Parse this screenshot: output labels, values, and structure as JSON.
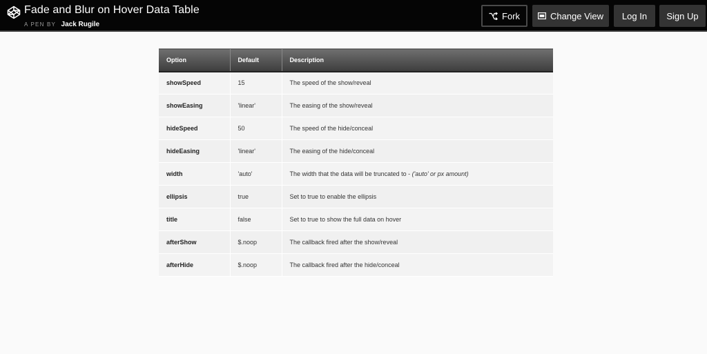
{
  "header": {
    "title": "Fade and Blur on Hover Data Table",
    "a_pen_by": "A PEN BY",
    "author": "Jack Rugile",
    "buttons": {
      "fork": "Fork",
      "change_view": "Change View",
      "log_in": "Log In",
      "sign_up": "Sign Up"
    }
  },
  "table": {
    "headers": [
      "Option",
      "Default",
      "Description"
    ],
    "rows": [
      {
        "option": "showSpeed",
        "default": "15",
        "description": "The speed of the show/reveal",
        "note": ""
      },
      {
        "option": "showEasing",
        "default": "'linear'",
        "description": "The easing of the show/reveal",
        "note": ""
      },
      {
        "option": "hideSpeed",
        "default": "50",
        "description": "The speed of the hide/conceal",
        "note": ""
      },
      {
        "option": "hideEasing",
        "default": "'linear'",
        "description": "The easing of the hide/conceal",
        "note": ""
      },
      {
        "option": "width",
        "default": "'auto'",
        "description": "The width that the data will be truncated to - ",
        "note": "('auto' or px amount)"
      },
      {
        "option": "ellipsis",
        "default": "true",
        "description": "Set to true to enable the ellipsis",
        "note": ""
      },
      {
        "option": "title",
        "default": "false",
        "description": "Set to true to show the full data on hover",
        "note": ""
      },
      {
        "option": "afterShow",
        "default": "$.noop",
        "description": "The callback fired after the show/reveal",
        "note": ""
      },
      {
        "option": "afterHide",
        "default": "$.noop",
        "description": "The callback fired after the hide/conceal",
        "note": ""
      }
    ]
  },
  "colors": {
    "topbar": "#050505",
    "button": "#333333",
    "header_cell": "#4f4f4f",
    "row": "#f3f3f3"
  },
  "icons": {
    "logo": "codepen-logo-icon",
    "fork": "fork-icon",
    "change_view": "change-view-icon"
  }
}
